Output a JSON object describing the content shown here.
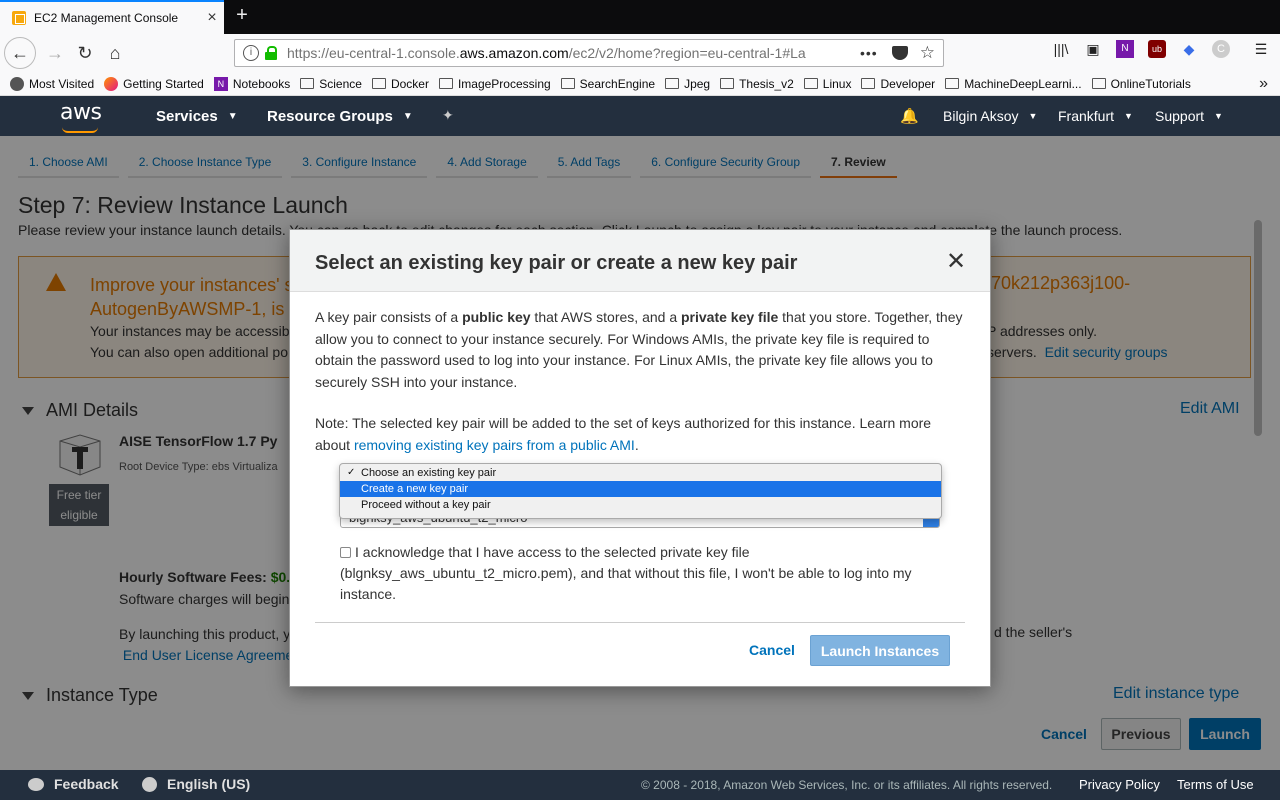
{
  "browser": {
    "tab_title": "EC2 Management Console",
    "url_prefix": "https://eu-central-1.console.",
    "url_domain": "aws.amazon.com",
    "url_suffix": "/ec2/v2/home?region=eu-central-1#La",
    "bookmarks": [
      "Most Visited",
      "Getting Started",
      "Notebooks",
      "Science",
      "Docker",
      "ImageProcessing",
      "SearchEngine",
      "Jpeg",
      "Thesis_v2",
      "Linux",
      "Developer",
      "MachineDeepLearni...",
      "OnlineTutorials"
    ]
  },
  "aws_header": {
    "logo": "aws",
    "services": "Services",
    "resource_groups": "Resource Groups",
    "user": "Bilgin Aksoy",
    "region": "Frankfurt",
    "support": "Support"
  },
  "wizard": {
    "steps": [
      "1. Choose AMI",
      "2. Choose Instance Type",
      "3. Configure Instance",
      "4. Add Storage",
      "5. Add Tags",
      "6. Configure Security Group",
      "7. Review"
    ],
    "active_step": 6,
    "title": "Step 7: Review Instance Launch",
    "description": "Please review your instance launch details. You can go back to edit changes for each section. Click Launch to assign a key pair to your instance and complete the launch process.",
    "warning_title_left": "Improve your instances' s",
    "warning_title_left2": "AutogenByAWSMP-1, is",
    "warning_title_right": "l70k212p363j100-",
    "warning_text_left1": "Your instances may be accessib",
    "warning_text_left2": "You can also open additional po",
    "warning_text_right1": "P addresses only.",
    "warning_text_right2": "servers.",
    "edit_security_groups": "Edit security groups",
    "ami_section": "AMI Details",
    "edit_ami": "Edit AMI",
    "ami_name": "AISE TensorFlow 1.7 Py",
    "ami_sub": "Root Device Type: ebs    Virtualiza",
    "free_tier": "Free tier eligible",
    "fees_label": "Hourly Software Fees:",
    "fees_value": "$0.",
    "fees_text": "Software charges will begin",
    "launch_note": "By launching this product, y",
    "launch_note_right": "d the seller's",
    "eula": "End User License Agreeme",
    "instance_type_section": "Instance Type",
    "edit_instance_type": "Edit instance type",
    "cancel": "Cancel",
    "previous": "Previous",
    "launch": "Launch"
  },
  "modal": {
    "title": "Select an existing key pair or create a new key pair",
    "p1_a": "A key pair consists of a ",
    "p1_b": "public key",
    "p1_c": " that AWS stores, and a ",
    "p1_d": "private key file",
    "p1_e": " that you store. Together, they allow you to connect to your instance securely. For Windows AMIs, the private key file is required to obtain the password used to log into your instance. For Linux AMIs, the private key file allows you to securely SSH into your instance.",
    "p2": "Note: The selected key pair will be added to the set of keys authorized for this instance. Learn more about ",
    "p2_link": "removing existing key pairs from a public AMI",
    "p2_end": ".",
    "dropdown_options": [
      "Choose an existing key pair",
      "Create a new key pair",
      "Proceed without a key pair"
    ],
    "dropdown_checked": 0,
    "dropdown_highlighted": 1,
    "select_behind_value": "blgnksy_aws_ubuntu_t2_micro",
    "ack_text": "I acknowledge that I have access to the selected private key file (blgnksy_aws_ubuntu_t2_micro.pem), and that without this file, I won't be able to log into my instance.",
    "cancel": "Cancel",
    "launch_instances": "Launch Instances"
  },
  "footer": {
    "feedback": "Feedback",
    "language": "English (US)",
    "copyright": "© 2008 - 2018, Amazon Web Services, Inc. or its affiliates. All rights reserved.",
    "privacy": "Privacy Policy",
    "terms": "Terms of Use"
  }
}
